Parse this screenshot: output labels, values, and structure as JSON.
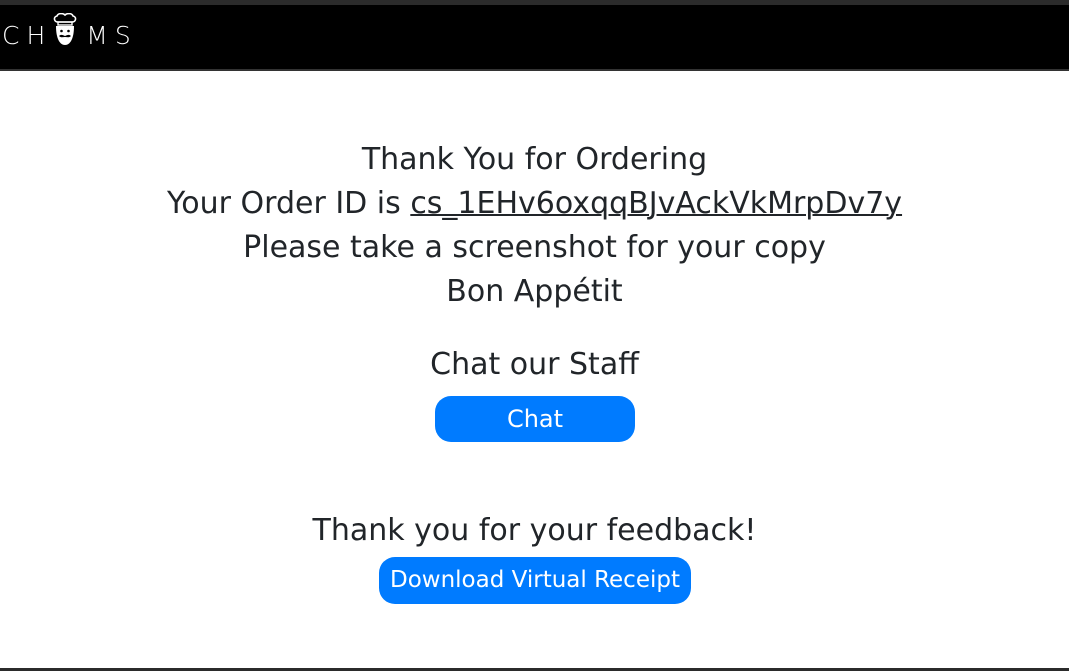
{
  "navbar": {
    "brand_prefix": "CH",
    "brand_suffix": "MS",
    "brand_icon": "chef-hat-icon"
  },
  "confirmation": {
    "thank_you": "Thank You for Ordering",
    "order_id_prefix": "Your Order ID is ",
    "order_id": "cs_1EHv6oxqqBJvAckVkMrpDv7y",
    "screenshot_note": "Please take a screenshot for your copy",
    "bon_appetit": "Bon Appétit"
  },
  "chat": {
    "heading": "Chat our Staff",
    "button_label": "Chat"
  },
  "feedback": {
    "heading": "Thank you for your feedback!",
    "button_label": "Download Virtual Receipt"
  },
  "colors": {
    "navbar_bg": "#000000",
    "accent": "#007bff",
    "text": "#212529"
  }
}
